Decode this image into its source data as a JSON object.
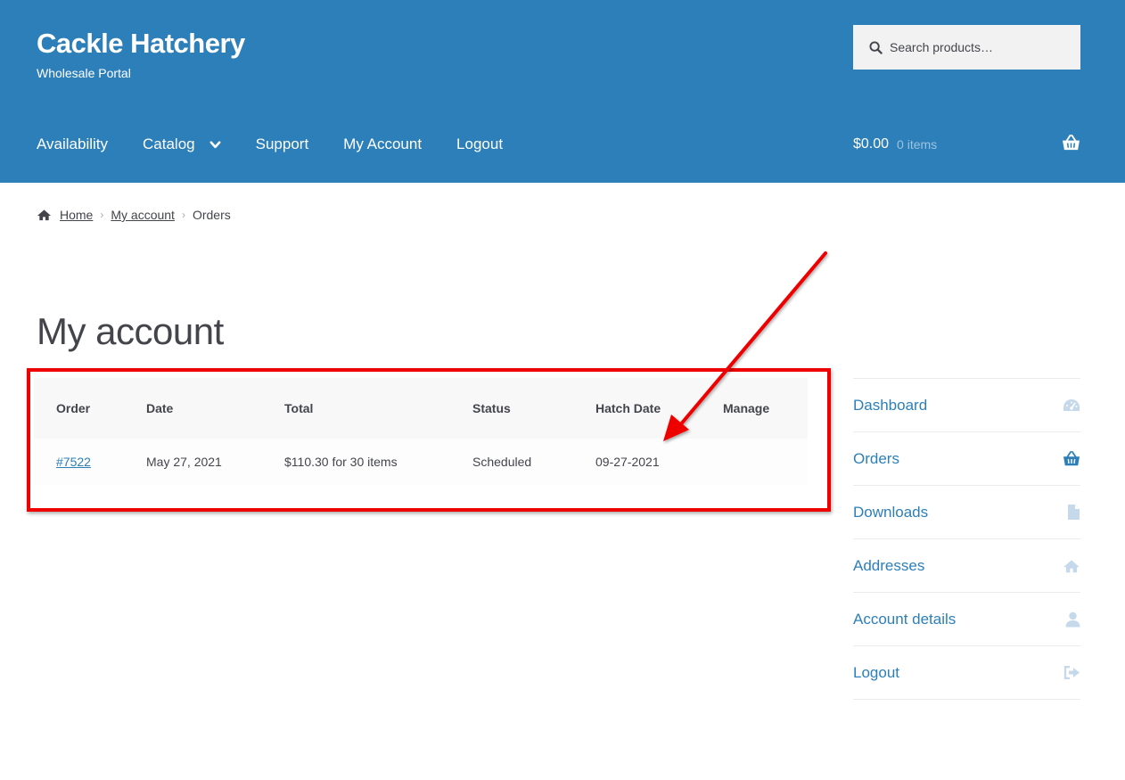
{
  "header": {
    "site_title": "Cackle Hatchery",
    "tagline": "Wholesale Portal",
    "background": "#2c7fb8",
    "search": {
      "placeholder": "Search products…",
      "value": ""
    },
    "nav": [
      {
        "label": "Availability"
      },
      {
        "label": "Catalog",
        "has_dropdown": true
      },
      {
        "label": "Support"
      },
      {
        "label": "My Account"
      },
      {
        "label": "Logout"
      }
    ],
    "cart": {
      "amount": "$0.00",
      "count": "0 items",
      "icon": "basket-icon"
    }
  },
  "breadcrumb": {
    "home": "Home",
    "my_account": "My account",
    "current": "Orders"
  },
  "page": {
    "title": "My account"
  },
  "orders_table": {
    "columns": [
      "Order",
      "Date",
      "Total",
      "Status",
      "Hatch Date",
      "Manage"
    ],
    "rows": [
      {
        "order": "#7522",
        "date": "May 27, 2021",
        "total": "$110.30 for 30 items",
        "status": "Scheduled",
        "hatch_date": "09-27-2021",
        "manage": ""
      }
    ]
  },
  "account_nav": [
    {
      "label": "Dashboard",
      "icon": "dashboard-icon",
      "active": false
    },
    {
      "label": "Orders",
      "icon": "basket-icon",
      "active": true
    },
    {
      "label": "Downloads",
      "icon": "file-icon",
      "active": false
    },
    {
      "label": "Addresses",
      "icon": "home-icon",
      "active": false
    },
    {
      "label": "Account details",
      "icon": "user-icon",
      "active": false
    },
    {
      "label": "Logout",
      "icon": "sign-out-icon",
      "active": false
    }
  ],
  "annotation": {
    "color": "#ee0000"
  }
}
